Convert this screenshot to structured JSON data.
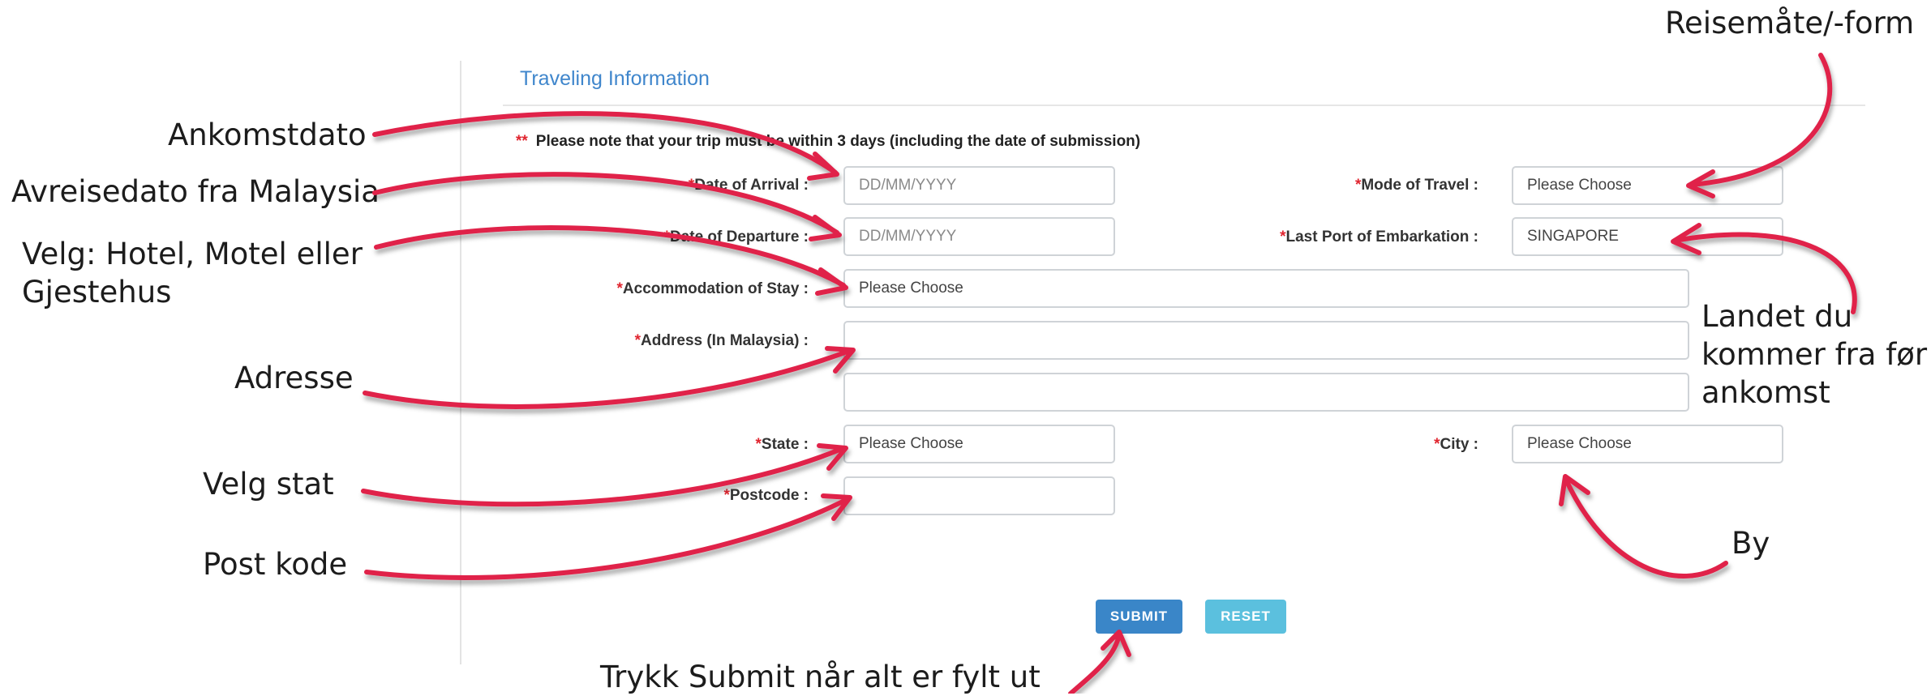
{
  "section": {
    "title": "Traveling Information"
  },
  "note": {
    "marker": "**",
    "text": "Please note that your trip must be within 3 days (including the date of submission)"
  },
  "required_mark": "*",
  "fields": {
    "date_of_arrival": {
      "label": "Date of Arrival :",
      "placeholder": "DD/MM/YYYY"
    },
    "date_of_departure": {
      "label": "Date of Departure :",
      "placeholder": "DD/MM/YYYY"
    },
    "accommodation": {
      "label": "Accommodation of Stay :",
      "value": "Please Choose"
    },
    "address": {
      "label": "Address (In Malaysia) :",
      "line1": "",
      "line2": ""
    },
    "state": {
      "label": "State :",
      "value": "Please Choose"
    },
    "postcode": {
      "label": "Postcode :",
      "value": ""
    },
    "mode_of_travel": {
      "label": "Mode of Travel :",
      "value": "Please Choose"
    },
    "last_port": {
      "label": "Last Port of Embarkation :",
      "value": "SINGAPORE"
    },
    "city": {
      "label": "City :",
      "value": "Please Choose"
    }
  },
  "buttons": {
    "submit": "SUBMIT",
    "reset": "RESET"
  },
  "annotations": {
    "arrival": "Ankomstdato",
    "departure": "Avreisedato fra Malaysia",
    "accommodation_line1": "Velg: Hotel, Motel eller",
    "accommodation_line2": "Gjestehus",
    "address": "Adresse",
    "state": "Velg stat",
    "postcode": "Post kode",
    "mode": "Reisemåte/-form",
    "port_line1": "Landet du",
    "port_line2": "kommer fra før",
    "port_line3": "ankomst",
    "city": "By",
    "submit": "Trykk Submit når alt er fylt ut"
  },
  "colors": {
    "accent_blue": "#3f86cc",
    "required_red": "#e0252f",
    "arrow_red": "#e0234a",
    "submit_bg": "#3a86c8",
    "reset_bg": "#5bc0de"
  }
}
